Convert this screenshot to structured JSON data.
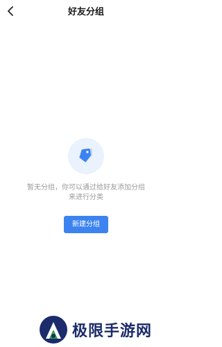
{
  "header": {
    "title": "好友分组",
    "back_icon": "chevron-left-icon"
  },
  "empty_state": {
    "icon": "tag-icon",
    "message": "暂无分组，你可以通过给好友添加分组来进行分类"
  },
  "actions": {
    "new_group_label": "新建分组"
  },
  "watermark": {
    "text": "极限手游网"
  },
  "colors": {
    "accent": "#3d83f0",
    "icon_circle_bg": "#e9f2fd",
    "muted_text": "#9a9a9a",
    "watermark_navy": "#1b2b6b",
    "watermark_green": "#2ea043"
  }
}
